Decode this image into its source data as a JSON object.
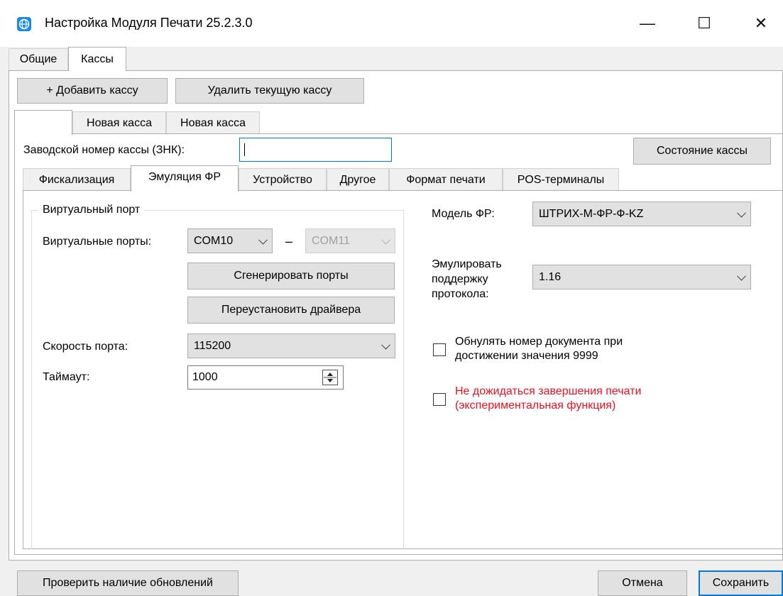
{
  "window": {
    "title": "Настройка Модуля Печати 25.2.3.0",
    "minimize_glyph": "—",
    "maximize_glyph": "☐",
    "close_glyph": "✕"
  },
  "top_tabs": [
    "Общие",
    "Кассы"
  ],
  "toolbar": {
    "add_label": "+ Добавить кассу",
    "delete_label": "Удалить текущую кассу"
  },
  "kassa_tabs": [
    "",
    "Новая касса",
    "Новая касса"
  ],
  "znk": {
    "label": "Заводской номер кассы (ЗНК):",
    "value": "",
    "status_button": "Состояние кассы"
  },
  "sub_tabs": [
    "Фискализация",
    "Эмуляция ФР",
    "Устройство",
    "Другое",
    "Формат печати",
    "POS-терминалы"
  ],
  "virtual_port": {
    "group_title": "Виртуальный порт",
    "ports_label": "Виртуальные порты:",
    "port1": "COM10",
    "dash": "–",
    "port2": "COM11",
    "generate_button": "Сгенерировать порты",
    "reinstall_button": "Переустановить драйвера",
    "speed_label": "Скорость порта:",
    "speed_value": "115200",
    "timeout_label": "Таймаут:",
    "timeout_value": "1000"
  },
  "right": {
    "model_label": "Модель ФР:",
    "model_value": "ШТРИХ-М-ФР-Ф-KZ",
    "protocol_label_1": "Эмулировать",
    "protocol_label_2": "поддержку",
    "protocol_label_3": "протокола:",
    "protocol_value": "1.16",
    "reset_doc_line1": "Обнулять номер документа при",
    "reset_doc_line2": "достижении значения 9999",
    "no_wait_line1": "Не дожидаться завершения печати",
    "no_wait_line2": "(экспериментальная функция)"
  },
  "footer": {
    "check_updates": "Проверить наличие обновлений",
    "cancel": "Отмена",
    "save": "Сохранить"
  },
  "colors": {
    "accent": "#0078d7",
    "warning_text": "#e81123"
  }
}
